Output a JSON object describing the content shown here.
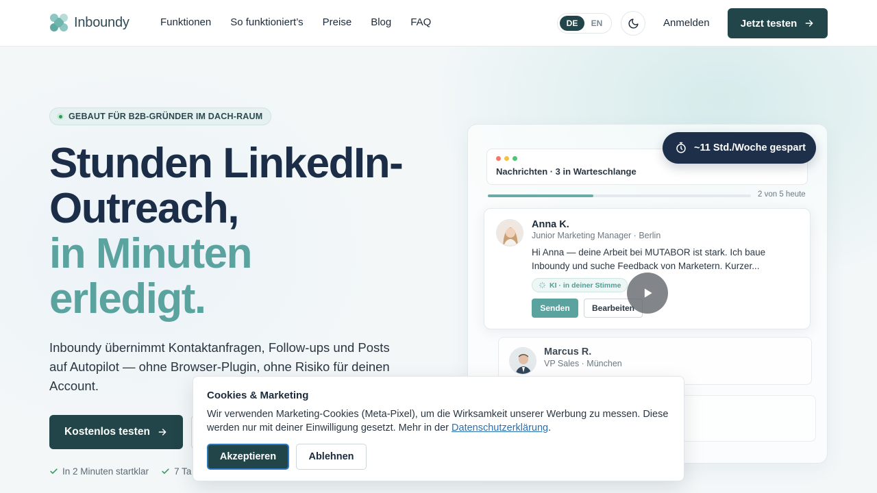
{
  "nav": {
    "logo_text": "Inboundy",
    "links": [
      "Funktionen",
      "So funktioniert’s",
      "Preise",
      "Blog",
      "FAQ"
    ],
    "lang_de": "DE",
    "lang_en": "EN",
    "active_lang": "DE",
    "login_label": "Anmelden",
    "cta_label": "Jetzt testen"
  },
  "hero": {
    "badge": "GEBAUT FÜR B2B-GRÜNDER IM DACH-RAUM",
    "headline_line1": "Stunden LinkedIn-",
    "headline_line2": "Outreach,",
    "headline_line3": "in Minuten",
    "headline_line4": "erledigt.",
    "subtitle": "Inboundy übernimmt Kontaktanfragen, Follow-ups und Posts auf Autopilot — ohne Browser-Plugin, ohne Risiko für deinen Account.",
    "primary_cta": "Kostenlos testen",
    "checks": [
      "In 2 Minuten startklar",
      "7 Ta"
    ]
  },
  "preview": {
    "saved_pill": "~11 Std./Woche gespart",
    "messages_title": "Nachrichten · 3 in Warteschlange",
    "progress_label": "2 von 5 heute",
    "progress_done": 2,
    "progress_total": 5,
    "contact1": {
      "name": "Anna K.",
      "role": "Junior Marketing Manager · Berlin",
      "message": "Hi Anna — deine Arbeit bei MUTABOR ist stark. Ich baue Inboundy und suche Feedback von Marketern. Kurzer...",
      "ai_chip": "KI · in deiner Stimme",
      "send_label": "Senden",
      "edit_label": "Bearbeiten"
    },
    "contact2": {
      "name": "Marcus R.",
      "role": "VP Sales · München"
    }
  },
  "cookie": {
    "title": "Cookies & Marketing",
    "text_before": "Wir verwenden Marketing-Cookies (Meta-Pixel), um die Wirksamkeit unserer Werbung zu messen. Diese werden nur mit deiner Einwilligung gesetzt. Mehr in der ",
    "link_label": "Datenschutzerklärung",
    "text_after": ".",
    "accept_label": "Akzeptieren",
    "reject_label": "Ablehnen"
  },
  "colors": {
    "brand_dark": "#214548",
    "brand_teal": "#5aa39f",
    "headline_dark": "#1b2d47",
    "pill_navy": "#1e2f4a",
    "link_blue": "#2a6fb0"
  },
  "icons": {
    "logo": "inboundy-logo-icon",
    "theme": "moon-icon",
    "arrow": "arrow-right-icon",
    "check": "check-icon",
    "clock": "stopwatch-icon",
    "play": "play-icon",
    "spark": "sparkle-icon"
  }
}
